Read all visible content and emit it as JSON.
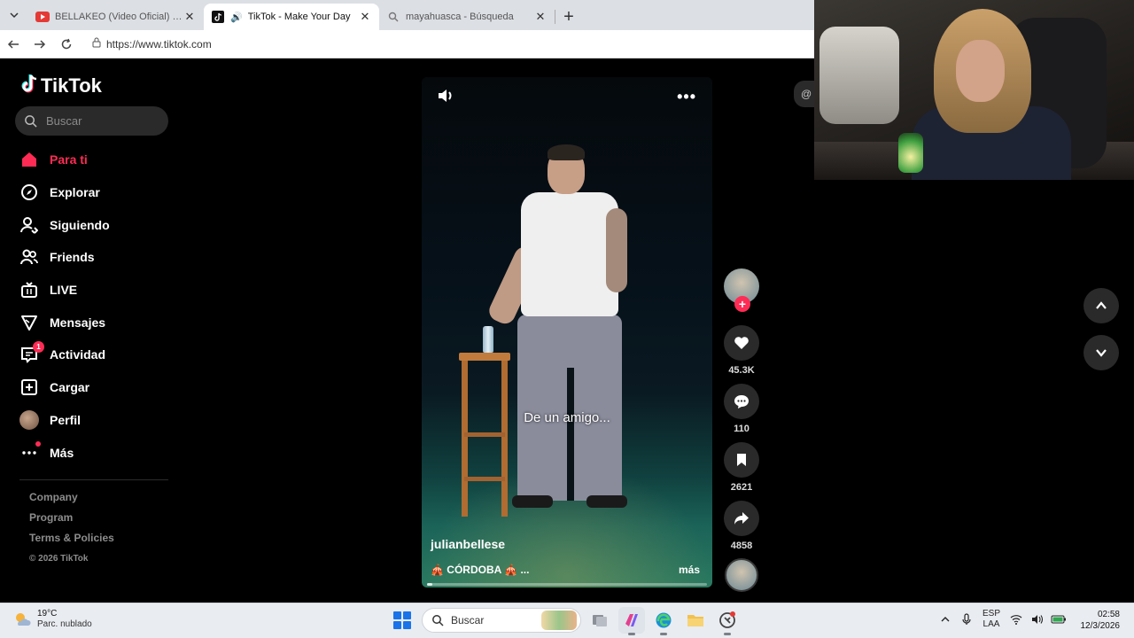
{
  "browser": {
    "tabs": [
      {
        "title": "BELLAKEO (Video Oficial) - Peso Pl",
        "favicon": "youtube-icon",
        "active": false
      },
      {
        "title": "TikTok - Make Your Day",
        "favicon": "tiktok-icon",
        "active": true
      },
      {
        "title": "mayahuasca - Búsqueda",
        "favicon": "search-icon",
        "active": false
      }
    ],
    "url": "https://www.tiktok.com"
  },
  "sidebar": {
    "logo_text": "TikTok",
    "search_placeholder": "Buscar",
    "items": [
      {
        "label": "Para ti",
        "icon": "home-icon",
        "active": true
      },
      {
        "label": "Explorar",
        "icon": "compass-icon"
      },
      {
        "label": "Siguiendo",
        "icon": "following-icon"
      },
      {
        "label": "Friends",
        "icon": "friends-icon"
      },
      {
        "label": "LIVE",
        "icon": "live-icon"
      },
      {
        "label": "Mensajes",
        "icon": "send-icon"
      },
      {
        "label": "Actividad",
        "icon": "activity-icon",
        "badge": "1"
      },
      {
        "label": "Cargar",
        "icon": "upload-icon"
      },
      {
        "label": "Perfil",
        "icon": "avatar"
      },
      {
        "label": "Más",
        "icon": "more-icon"
      }
    ],
    "footer": {
      "links": [
        "Company",
        "Program",
        "Terms & Policies"
      ],
      "copyright": "© 2026 TikTok"
    }
  },
  "video": {
    "caption": "De un amigo...",
    "author": "julianbellese",
    "description": "🎪 CÓRDOBA 🎪 ...",
    "more_label": "más",
    "progress": 0.02
  },
  "actions": {
    "likes": "45.3K",
    "comments": "110",
    "saves": "2621",
    "shares": "4858"
  },
  "taskbar": {
    "weather_temp": "19°C",
    "weather_desc": "Parc. nublado",
    "search_placeholder": "Buscar",
    "lang_top": "ESP",
    "lang_bottom": "LAA",
    "time": "02:58",
    "date": "12/3/2026"
  },
  "colors": {
    "accent": "#fe2c55",
    "background": "#000000"
  }
}
